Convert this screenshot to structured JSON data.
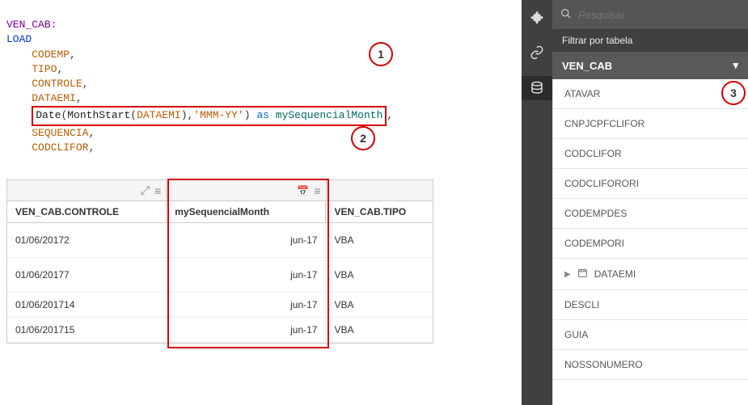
{
  "markers": {
    "one": "1",
    "two": "2",
    "three": "3"
  },
  "code": {
    "tableDecl": "VEN_CAB:",
    "load": "LOAD",
    "fields_before": [
      "CODEMP",
      "TIPO",
      "CONTROLE",
      "DATAEMI"
    ],
    "expr_func1": "Date",
    "expr_func2": "MonthStart",
    "expr_arg": "DATAEMI",
    "expr_fmt": "'MMM-YY'",
    "expr_as": "as",
    "expr_alias": "mySequencialMonth",
    "fields_after": [
      "SEQUENCIA",
      "CODCLIFOR"
    ]
  },
  "table": {
    "columns": [
      "VEN_CAB.CONTROLE",
      "mySequencialMonth",
      "VEN_CAB.TIPO"
    ],
    "rows": [
      {
        "c1": "01/06/20172",
        "c2": "jun-17",
        "c3": "VBA"
      },
      {
        "c1": "01/06/20177",
        "c2": "jun-17",
        "c3": "VBA"
      },
      {
        "c1": "01/06/201714",
        "c2": "jun-17",
        "c3": "VBA"
      },
      {
        "c1": "01/06/201715",
        "c2": "jun-17",
        "c3": "VBA"
      }
    ],
    "icon_expand": "⤢",
    "icon_menu": "≡",
    "icon_cal": "📅"
  },
  "side": {
    "search_placeholder": "Pesquisar",
    "filter_label": "Filtrar por tabela",
    "selected_table": "VEN_CAB",
    "fields": [
      {
        "label": "ATAVAR"
      },
      {
        "label": "CNPJCPFCLIFOR"
      },
      {
        "label": "CODCLIFOR"
      },
      {
        "label": "CODCLIFORORI"
      },
      {
        "label": "CODEMPDES"
      },
      {
        "label": "CODEMPORI"
      },
      {
        "label": "DATAEMI",
        "date": true
      },
      {
        "label": "DESCLI"
      },
      {
        "label": "GUIA"
      },
      {
        "label": "NOSSONUMERO"
      }
    ]
  }
}
